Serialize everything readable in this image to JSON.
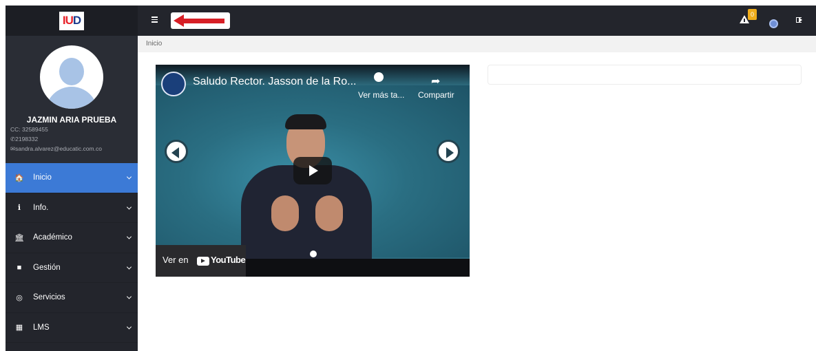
{
  "logo": {
    "text_a": "IU",
    "text_b": "D"
  },
  "user": {
    "name": "JAZMIN ARIA PRUEBA",
    "id_text": "CC: 32589455",
    "phone": "2198332",
    "email": "sandra.alvarez@educatic.com.co"
  },
  "nav": [
    {
      "label": "Inicio",
      "icon": "home-icon",
      "glyph": "🏠",
      "active": true
    },
    {
      "label": "Info.",
      "icon": "info-icon",
      "glyph": "ℹ",
      "active": false
    },
    {
      "label": "Académico",
      "icon": "university-icon",
      "glyph": "🏛",
      "active": false
    },
    {
      "label": "Gestión",
      "icon": "folder-icon",
      "glyph": "■",
      "active": false
    },
    {
      "label": "Servicios",
      "icon": "comment-icon",
      "glyph": "◎",
      "active": false
    },
    {
      "label": "LMS",
      "icon": "grid-icon",
      "glyph": "▦",
      "active": false
    }
  ],
  "topbar": {
    "notification_count": "0"
  },
  "breadcrumb": {
    "current": "Inicio"
  },
  "video": {
    "title": "Saludo Rector. Jasson de la Ro...",
    "watch_later": "Ver más ta...",
    "share": "Compartir",
    "watch_on_prefix": "Ver en",
    "youtube_word": "YouTube"
  },
  "colors": {
    "sidebar_bg": "#23252c",
    "active_nav": "#3c7ad6",
    "badge": "#f0ad1b",
    "arrow_red": "#d71f26"
  }
}
